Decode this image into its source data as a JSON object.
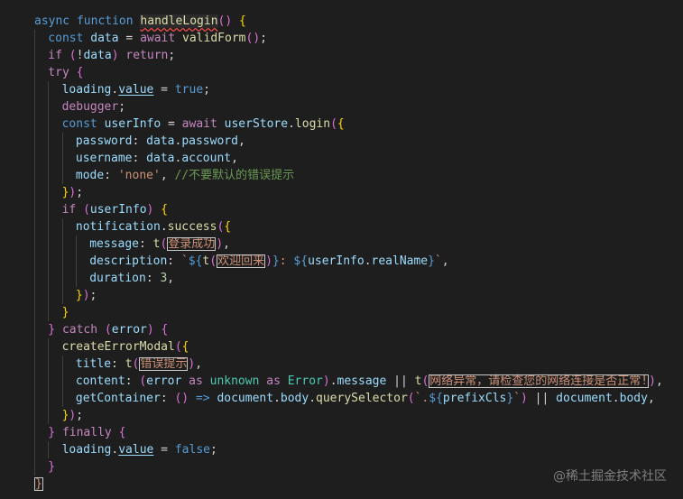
{
  "editor": {
    "language": "typescript",
    "lines": [
      {
        "indent": 0,
        "tokens": [
          [
            "kw",
            "async "
          ],
          [
            "kw",
            "function "
          ],
          [
            "fn-sq",
            "handleLogin"
          ],
          [
            "paren",
            "("
          ],
          [
            "paren",
            ")"
          ],
          [
            "punc",
            " "
          ],
          [
            "brace",
            "{"
          ]
        ]
      },
      {
        "indent": 1,
        "tokens": [
          [
            "kw",
            "const "
          ],
          [
            "var",
            "data"
          ],
          [
            "punc",
            " = "
          ],
          [
            "ctl",
            "await "
          ],
          [
            "fn",
            "validForm"
          ],
          [
            "paren",
            "("
          ],
          [
            "paren",
            ")"
          ],
          [
            "punc",
            ";"
          ]
        ]
      },
      {
        "indent": 1,
        "tokens": [
          [
            "ctl",
            "if "
          ],
          [
            "paren",
            "("
          ],
          [
            "punc",
            "!"
          ],
          [
            "var",
            "data"
          ],
          [
            "paren",
            ")"
          ],
          [
            "punc",
            " "
          ],
          [
            "ctl",
            "return"
          ],
          [
            "punc",
            ";"
          ]
        ]
      },
      {
        "indent": 1,
        "tokens": [
          [
            "ctl",
            "try "
          ],
          [
            "paren",
            "{"
          ]
        ]
      },
      {
        "indent": 2,
        "tokens": [
          [
            "var",
            "loading"
          ],
          [
            "punc",
            "."
          ],
          [
            "prop-u",
            "value"
          ],
          [
            "punc",
            " = "
          ],
          [
            "kw",
            "true"
          ],
          [
            "punc",
            ";"
          ]
        ]
      },
      {
        "indent": 2,
        "tokens": [
          [
            "ctl",
            "debugger"
          ],
          [
            "punc",
            ";"
          ]
        ]
      },
      {
        "indent": 2,
        "tokens": [
          [
            "kw",
            "const "
          ],
          [
            "var",
            "userInfo"
          ],
          [
            "punc",
            " = "
          ],
          [
            "ctl",
            "await "
          ],
          [
            "var",
            "userStore"
          ],
          [
            "punc",
            "."
          ],
          [
            "fn",
            "login"
          ],
          [
            "paren",
            "("
          ],
          [
            "brace",
            "{"
          ]
        ]
      },
      {
        "indent": 3,
        "tokens": [
          [
            "prop",
            "password"
          ],
          [
            "punc",
            ": "
          ],
          [
            "var",
            "data"
          ],
          [
            "punc",
            "."
          ],
          [
            "prop",
            "password"
          ],
          [
            "punc",
            ","
          ]
        ]
      },
      {
        "indent": 3,
        "tokens": [
          [
            "prop",
            "username"
          ],
          [
            "punc",
            ": "
          ],
          [
            "var",
            "data"
          ],
          [
            "punc",
            "."
          ],
          [
            "prop",
            "account"
          ],
          [
            "punc",
            ","
          ]
        ]
      },
      {
        "indent": 3,
        "tokens": [
          [
            "prop",
            "mode"
          ],
          [
            "punc",
            ": "
          ],
          [
            "str",
            "'none'"
          ],
          [
            "punc",
            ", "
          ],
          [
            "com",
            "//不要默认的错误提示"
          ]
        ]
      },
      {
        "indent": 2,
        "tokens": [
          [
            "brace",
            "}"
          ],
          [
            "paren",
            ")"
          ],
          [
            "punc",
            ";"
          ]
        ]
      },
      {
        "indent": 2,
        "tokens": [
          [
            "ctl",
            "if "
          ],
          [
            "paren",
            "("
          ],
          [
            "var",
            "userInfo"
          ],
          [
            "paren",
            ")"
          ],
          [
            "punc",
            " "
          ],
          [
            "brace",
            "{"
          ]
        ]
      },
      {
        "indent": 3,
        "tokens": [
          [
            "var",
            "notification"
          ],
          [
            "punc",
            "."
          ],
          [
            "fn",
            "success"
          ],
          [
            "paren",
            "("
          ],
          [
            "brace",
            "{"
          ]
        ]
      },
      {
        "indent": 4,
        "tokens": [
          [
            "prop",
            "message"
          ],
          [
            "punc",
            ": "
          ],
          [
            "fn",
            "t"
          ],
          [
            "paren",
            "("
          ],
          [
            "cn",
            "登录成功"
          ],
          [
            "paren",
            ")"
          ],
          [
            "punc",
            ","
          ]
        ]
      },
      {
        "indent": 4,
        "tokens": [
          [
            "prop",
            "description"
          ],
          [
            "punc",
            ": "
          ],
          [
            "str",
            "`"
          ],
          [
            "tmpl",
            "${"
          ],
          [
            "fn",
            "t"
          ],
          [
            "paren",
            "("
          ],
          [
            "cn",
            "欢迎回来"
          ],
          [
            "paren",
            ")"
          ],
          [
            "tmpl",
            "}"
          ],
          [
            "str",
            ": "
          ],
          [
            "tmpl",
            "${"
          ],
          [
            "var",
            "userInfo"
          ],
          [
            "punc",
            "."
          ],
          [
            "prop",
            "realName"
          ],
          [
            "tmpl",
            "}"
          ],
          [
            "str",
            "`"
          ],
          [
            "punc",
            ","
          ]
        ]
      },
      {
        "indent": 4,
        "tokens": [
          [
            "prop",
            "duration"
          ],
          [
            "punc",
            ": "
          ],
          [
            "num",
            "3"
          ],
          [
            "punc",
            ","
          ]
        ]
      },
      {
        "indent": 3,
        "tokens": [
          [
            "brace",
            "}"
          ],
          [
            "paren",
            ")"
          ],
          [
            "punc",
            ";"
          ]
        ]
      },
      {
        "indent": 2,
        "tokens": [
          [
            "brace",
            "}"
          ]
        ]
      },
      {
        "indent": 1,
        "tokens": [
          [
            "paren",
            "}"
          ],
          [
            "punc",
            " "
          ],
          [
            "ctl",
            "catch "
          ],
          [
            "paren",
            "("
          ],
          [
            "var",
            "error"
          ],
          [
            "paren",
            ")"
          ],
          [
            "punc",
            " "
          ],
          [
            "paren",
            "{"
          ]
        ]
      },
      {
        "indent": 2,
        "tokens": [
          [
            "fn",
            "createErrorModal"
          ],
          [
            "paren",
            "("
          ],
          [
            "brace",
            "{"
          ]
        ]
      },
      {
        "indent": 3,
        "tokens": [
          [
            "prop",
            "title"
          ],
          [
            "punc",
            ": "
          ],
          [
            "fn",
            "t"
          ],
          [
            "paren",
            "("
          ],
          [
            "cn",
            "错误提示"
          ],
          [
            "paren",
            ")"
          ],
          [
            "punc",
            ","
          ]
        ]
      },
      {
        "indent": 3,
        "tokens": [
          [
            "prop",
            "content"
          ],
          [
            "punc",
            ": "
          ],
          [
            "paren",
            "("
          ],
          [
            "var",
            "error"
          ],
          [
            "punc",
            " "
          ],
          [
            "ctl",
            "as "
          ],
          [
            "type",
            "unknown"
          ],
          [
            "punc",
            " "
          ],
          [
            "ctl",
            "as "
          ],
          [
            "type",
            "Error"
          ],
          [
            "paren",
            ")"
          ],
          [
            "punc",
            "."
          ],
          [
            "prop",
            "message"
          ],
          [
            "punc",
            " || "
          ],
          [
            "fn",
            "t"
          ],
          [
            "paren",
            "("
          ],
          [
            "cn",
            "网络异常，请检查您的网络连接是否正常!"
          ],
          [
            "paren",
            ")"
          ],
          [
            "punc",
            ","
          ]
        ]
      },
      {
        "indent": 3,
        "tokens": [
          [
            "prop",
            "getContainer"
          ],
          [
            "punc",
            ": "
          ],
          [
            "paren",
            "("
          ],
          [
            "paren",
            ")"
          ],
          [
            "punc",
            " "
          ],
          [
            "kw",
            "=>"
          ],
          [
            "punc",
            " "
          ],
          [
            "var",
            "document"
          ],
          [
            "punc",
            "."
          ],
          [
            "prop",
            "body"
          ],
          [
            "punc",
            "."
          ],
          [
            "fn",
            "querySelector"
          ],
          [
            "paren",
            "("
          ],
          [
            "str",
            "`."
          ],
          [
            "tmpl",
            "${"
          ],
          [
            "var",
            "prefixCls"
          ],
          [
            "tmpl",
            "}"
          ],
          [
            "str",
            "`"
          ],
          [
            "paren",
            ")"
          ],
          [
            "punc",
            " || "
          ],
          [
            "var",
            "document"
          ],
          [
            "punc",
            "."
          ],
          [
            "prop",
            "body"
          ],
          [
            "punc",
            ","
          ]
        ]
      },
      {
        "indent": 2,
        "tokens": [
          [
            "brace",
            "}"
          ],
          [
            "paren",
            ")"
          ],
          [
            "punc",
            ";"
          ]
        ]
      },
      {
        "indent": 1,
        "tokens": [
          [
            "paren",
            "}"
          ],
          [
            "punc",
            " "
          ],
          [
            "ctl",
            "finally "
          ],
          [
            "paren",
            "{"
          ]
        ]
      },
      {
        "indent": 2,
        "tokens": [
          [
            "var",
            "loading"
          ],
          [
            "punc",
            "."
          ],
          [
            "prop-u",
            "value"
          ],
          [
            "punc",
            " = "
          ],
          [
            "kw",
            "false"
          ],
          [
            "punc",
            ";"
          ]
        ]
      },
      {
        "indent": 1,
        "tokens": [
          [
            "paren",
            "}"
          ]
        ]
      },
      {
        "indent": 0,
        "tokens": [
          [
            "brace-box",
            "}"
          ]
        ]
      }
    ]
  },
  "watermark": {
    "text": "@稀土掘金技术社区"
  },
  "colors": {
    "background": "#1e1e1e",
    "indent_guide": "#404040"
  }
}
